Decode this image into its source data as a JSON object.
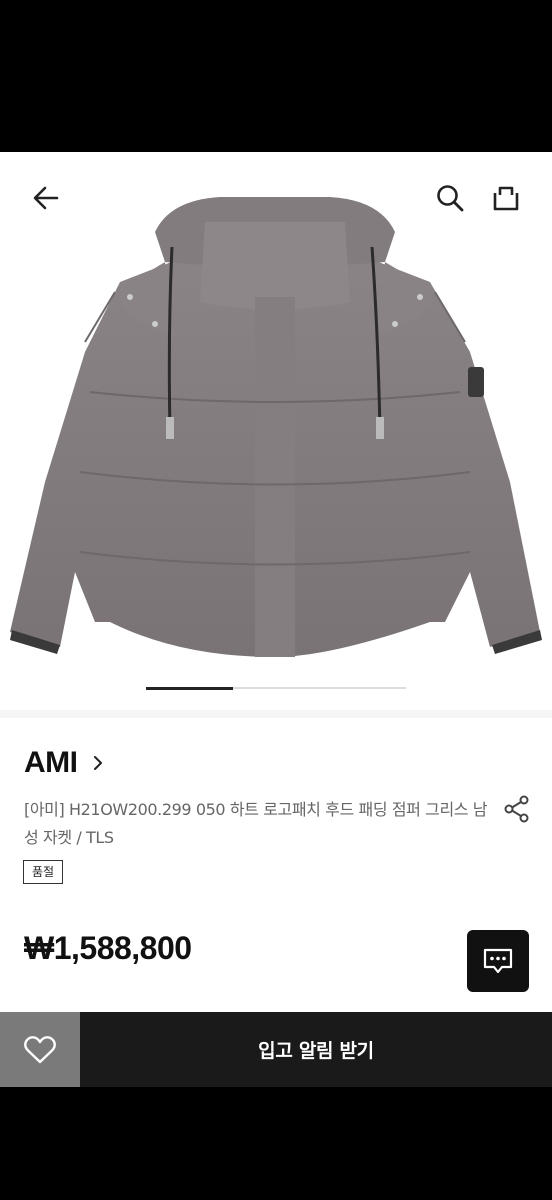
{
  "header": {
    "back_icon": "arrow-left-icon",
    "search_icon": "search-icon",
    "cart_icon": "shopping-bag-icon"
  },
  "gallery": {
    "image_subject": "gray hooded puffer jacket",
    "current_page": 1,
    "page_count": 3
  },
  "product": {
    "brand": "AMI",
    "title": "[아미] H21OW200.299 050 하트 로고패치 후드 패딩 점퍼 그리스 남성 자켓 / TLS",
    "badge": "품절",
    "price": "₩1,588,800"
  },
  "actions": {
    "wish_icon": "heart-icon",
    "restock_label": "입고 알림 받기",
    "chat_icon": "chat-icon",
    "share_icon": "share-icon"
  },
  "colors": {
    "background": "#ffffff",
    "text_primary": "#111111",
    "text_secondary": "#666666",
    "cta": "#1a1a1a",
    "wish_button": "#7a7a7a"
  }
}
